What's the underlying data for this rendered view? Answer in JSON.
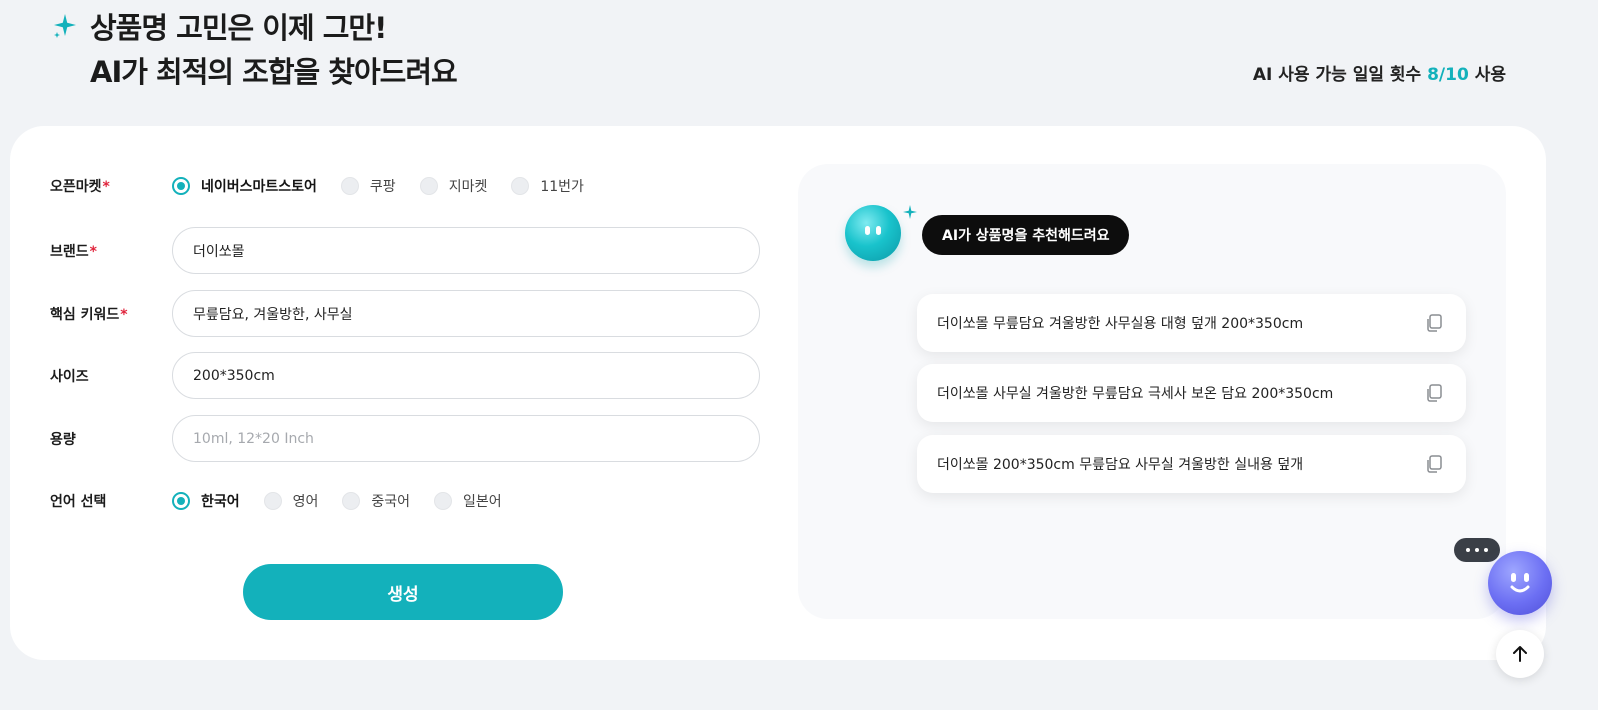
{
  "header": {
    "title_line1": "상품명 고민은 이제 그만!",
    "title_line2": "AI가 최적의 조합을 찾아드려요",
    "usage_prefix": "AI 사용 가능 일일 횟수 ",
    "usage_count": "8/10",
    "usage_suffix": " 사용"
  },
  "form": {
    "market": {
      "label": "오픈마켓",
      "required": "*",
      "options": [
        "네이버스마트스토어",
        "쿠팡",
        "지마켓",
        "11번가"
      ],
      "selected": "네이버스마트스토어"
    },
    "brand": {
      "label": "브랜드",
      "required": "*",
      "value": "더이쏘몰"
    },
    "keywords": {
      "label": "핵심 키워드",
      "required": "*",
      "value": "무릎담요, 겨울방한, 사무실"
    },
    "size": {
      "label": "사이즈",
      "value": "200*350cm"
    },
    "capacity": {
      "label": "용량",
      "placeholder": "10ml, 12*20 Inch"
    },
    "language": {
      "label": "언어 선택",
      "options": [
        "한국어",
        "영어",
        "중국어",
        "일본어"
      ],
      "selected": "한국어"
    },
    "generate_label": "생성"
  },
  "results": {
    "bubble": "AI가 상품명을 추천해드려요",
    "items": [
      "더이쏘몰 무릎담요 겨울방한 사무실용 대형 덮개 200*350cm",
      "더이쏘몰 사무실 겨울방한 무릎담요 극세사 보온 담요 200*350cm",
      "더이쏘몰 200*350cm 무릎담요 사무실 겨울방한 실내용 덮개"
    ]
  },
  "colors": {
    "accent": "#13b1bb",
    "required": "#e0243c",
    "chatbot": "#6c6ff3"
  },
  "icons": {
    "header": "sparkle-icon",
    "copy": "copy-icon",
    "chatbot": "chatbot-icon",
    "scroll_top": "arrow-up-icon"
  }
}
